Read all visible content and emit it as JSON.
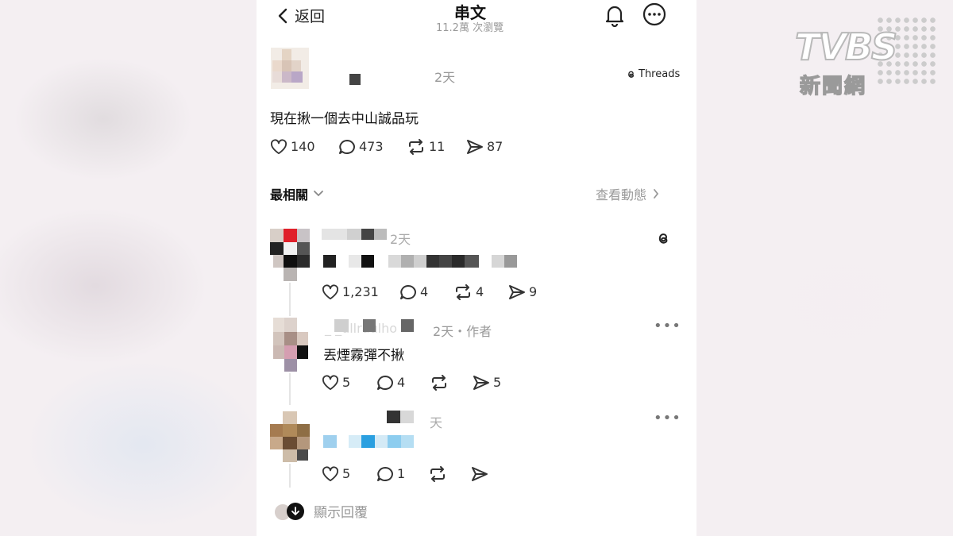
{
  "header": {
    "back_label": "返回",
    "title": "串文",
    "views": "11.2萬 次瀏覽"
  },
  "post": {
    "time": "2天",
    "platform": "Threads",
    "text": "現在揪一個去中山誠品玩",
    "likes": "140",
    "comments": "473",
    "reposts": "11",
    "shares": "87"
  },
  "sort": {
    "label": "最相關",
    "activity_link": "查看動態"
  },
  "replies": [
    {
      "time": "2天",
      "likes": "1,231",
      "comments": "4",
      "reposts": "4",
      "shares": "9"
    },
    {
      "username_partial": "_ _ullraulho",
      "time": "2天・作者",
      "text": "丟煙霧彈不揪",
      "likes": "5",
      "comments": "4",
      "shares": "5"
    },
    {
      "time": "天",
      "likes": "5",
      "comments": "1"
    }
  ],
  "show_replies_label": "顯示回覆",
  "watermark": {
    "brand": "TVBS",
    "subtitle": "新聞網"
  },
  "colors": {
    "background": "#f6f2f4",
    "panel": "#ffffff",
    "muted_text": "#999999",
    "icon": "#222222"
  },
  "icons": [
    "chevron-left-icon",
    "bell-icon",
    "more-icon",
    "threads-icon",
    "heart-icon",
    "comment-icon",
    "repost-icon",
    "share-icon",
    "chevron-down-icon",
    "chevron-right-icon",
    "arrow-down-icon"
  ]
}
